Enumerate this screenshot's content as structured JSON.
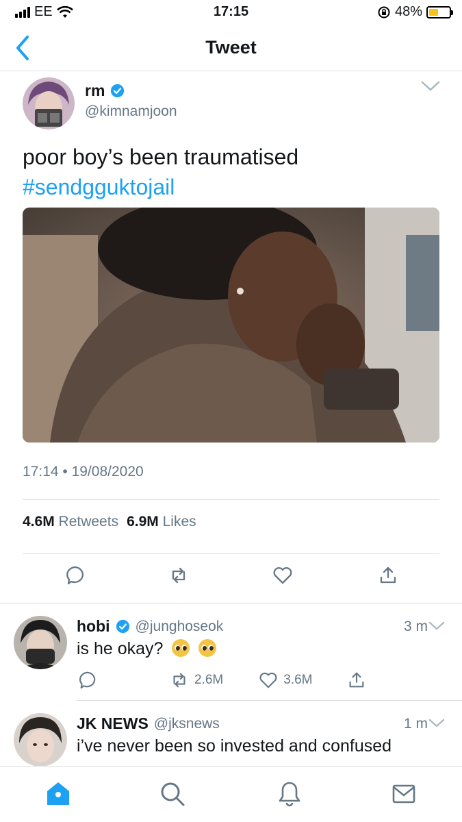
{
  "status_bar": {
    "carrier": "EE",
    "time": "17:15",
    "battery": "48%",
    "battery_level": 0.48
  },
  "nav": {
    "title": "Tweet"
  },
  "tweet": {
    "name": "rm",
    "handle": "@kimnamjoon",
    "text": "poor boy’s been traumatised",
    "hashtag": "#sendgguktojail",
    "timestamp": "17:14 • 19/08/2020",
    "retweets_count": "4.6M",
    "retweets_label": "Retweets",
    "likes_count": "6.9M",
    "likes_label": "Likes"
  },
  "replies": [
    {
      "name": "hobi",
      "handle": "@junghoseok",
      "time": "3 m",
      "text": "is he okay?",
      "retweets": "2.6M",
      "likes": "3.6M"
    },
    {
      "name": "JK NEWS",
      "handle": "@jksnews",
      "time": "1 m",
      "text": "i’ve never been so invested and confused"
    }
  ],
  "colors": {
    "accent": "#1da1f2",
    "muted": "#657786",
    "divider": "#d8dde1"
  },
  "tabs": [
    "home-icon",
    "search-icon",
    "bell-icon",
    "mail-icon"
  ]
}
